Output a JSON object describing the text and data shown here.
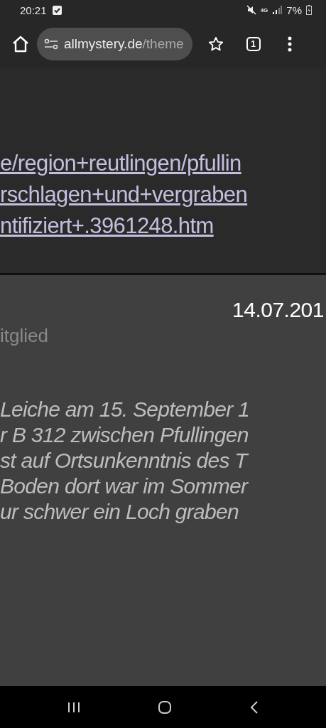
{
  "status_bar": {
    "time": "20:21",
    "network": "4G",
    "battery": "7%"
  },
  "browser": {
    "url_host": "allmystery.de",
    "url_path": "/theme",
    "tab_count": "1"
  },
  "link_lines": [
    "e/region+reutlingen/pfullin",
    "rschlagen+und+vergraben",
    "ntifiziert+.3961248.htm"
  ],
  "post": {
    "date": "14.07.201",
    "rank": "itglied",
    "quote_lines": [
      "Leiche am 15. September 1",
      "r B 312 zwischen Pfullingen",
      "st auf Ortsunkenntnis des T",
      "Boden dort war im Sommer",
      "ur schwer ein Loch graben"
    ]
  }
}
